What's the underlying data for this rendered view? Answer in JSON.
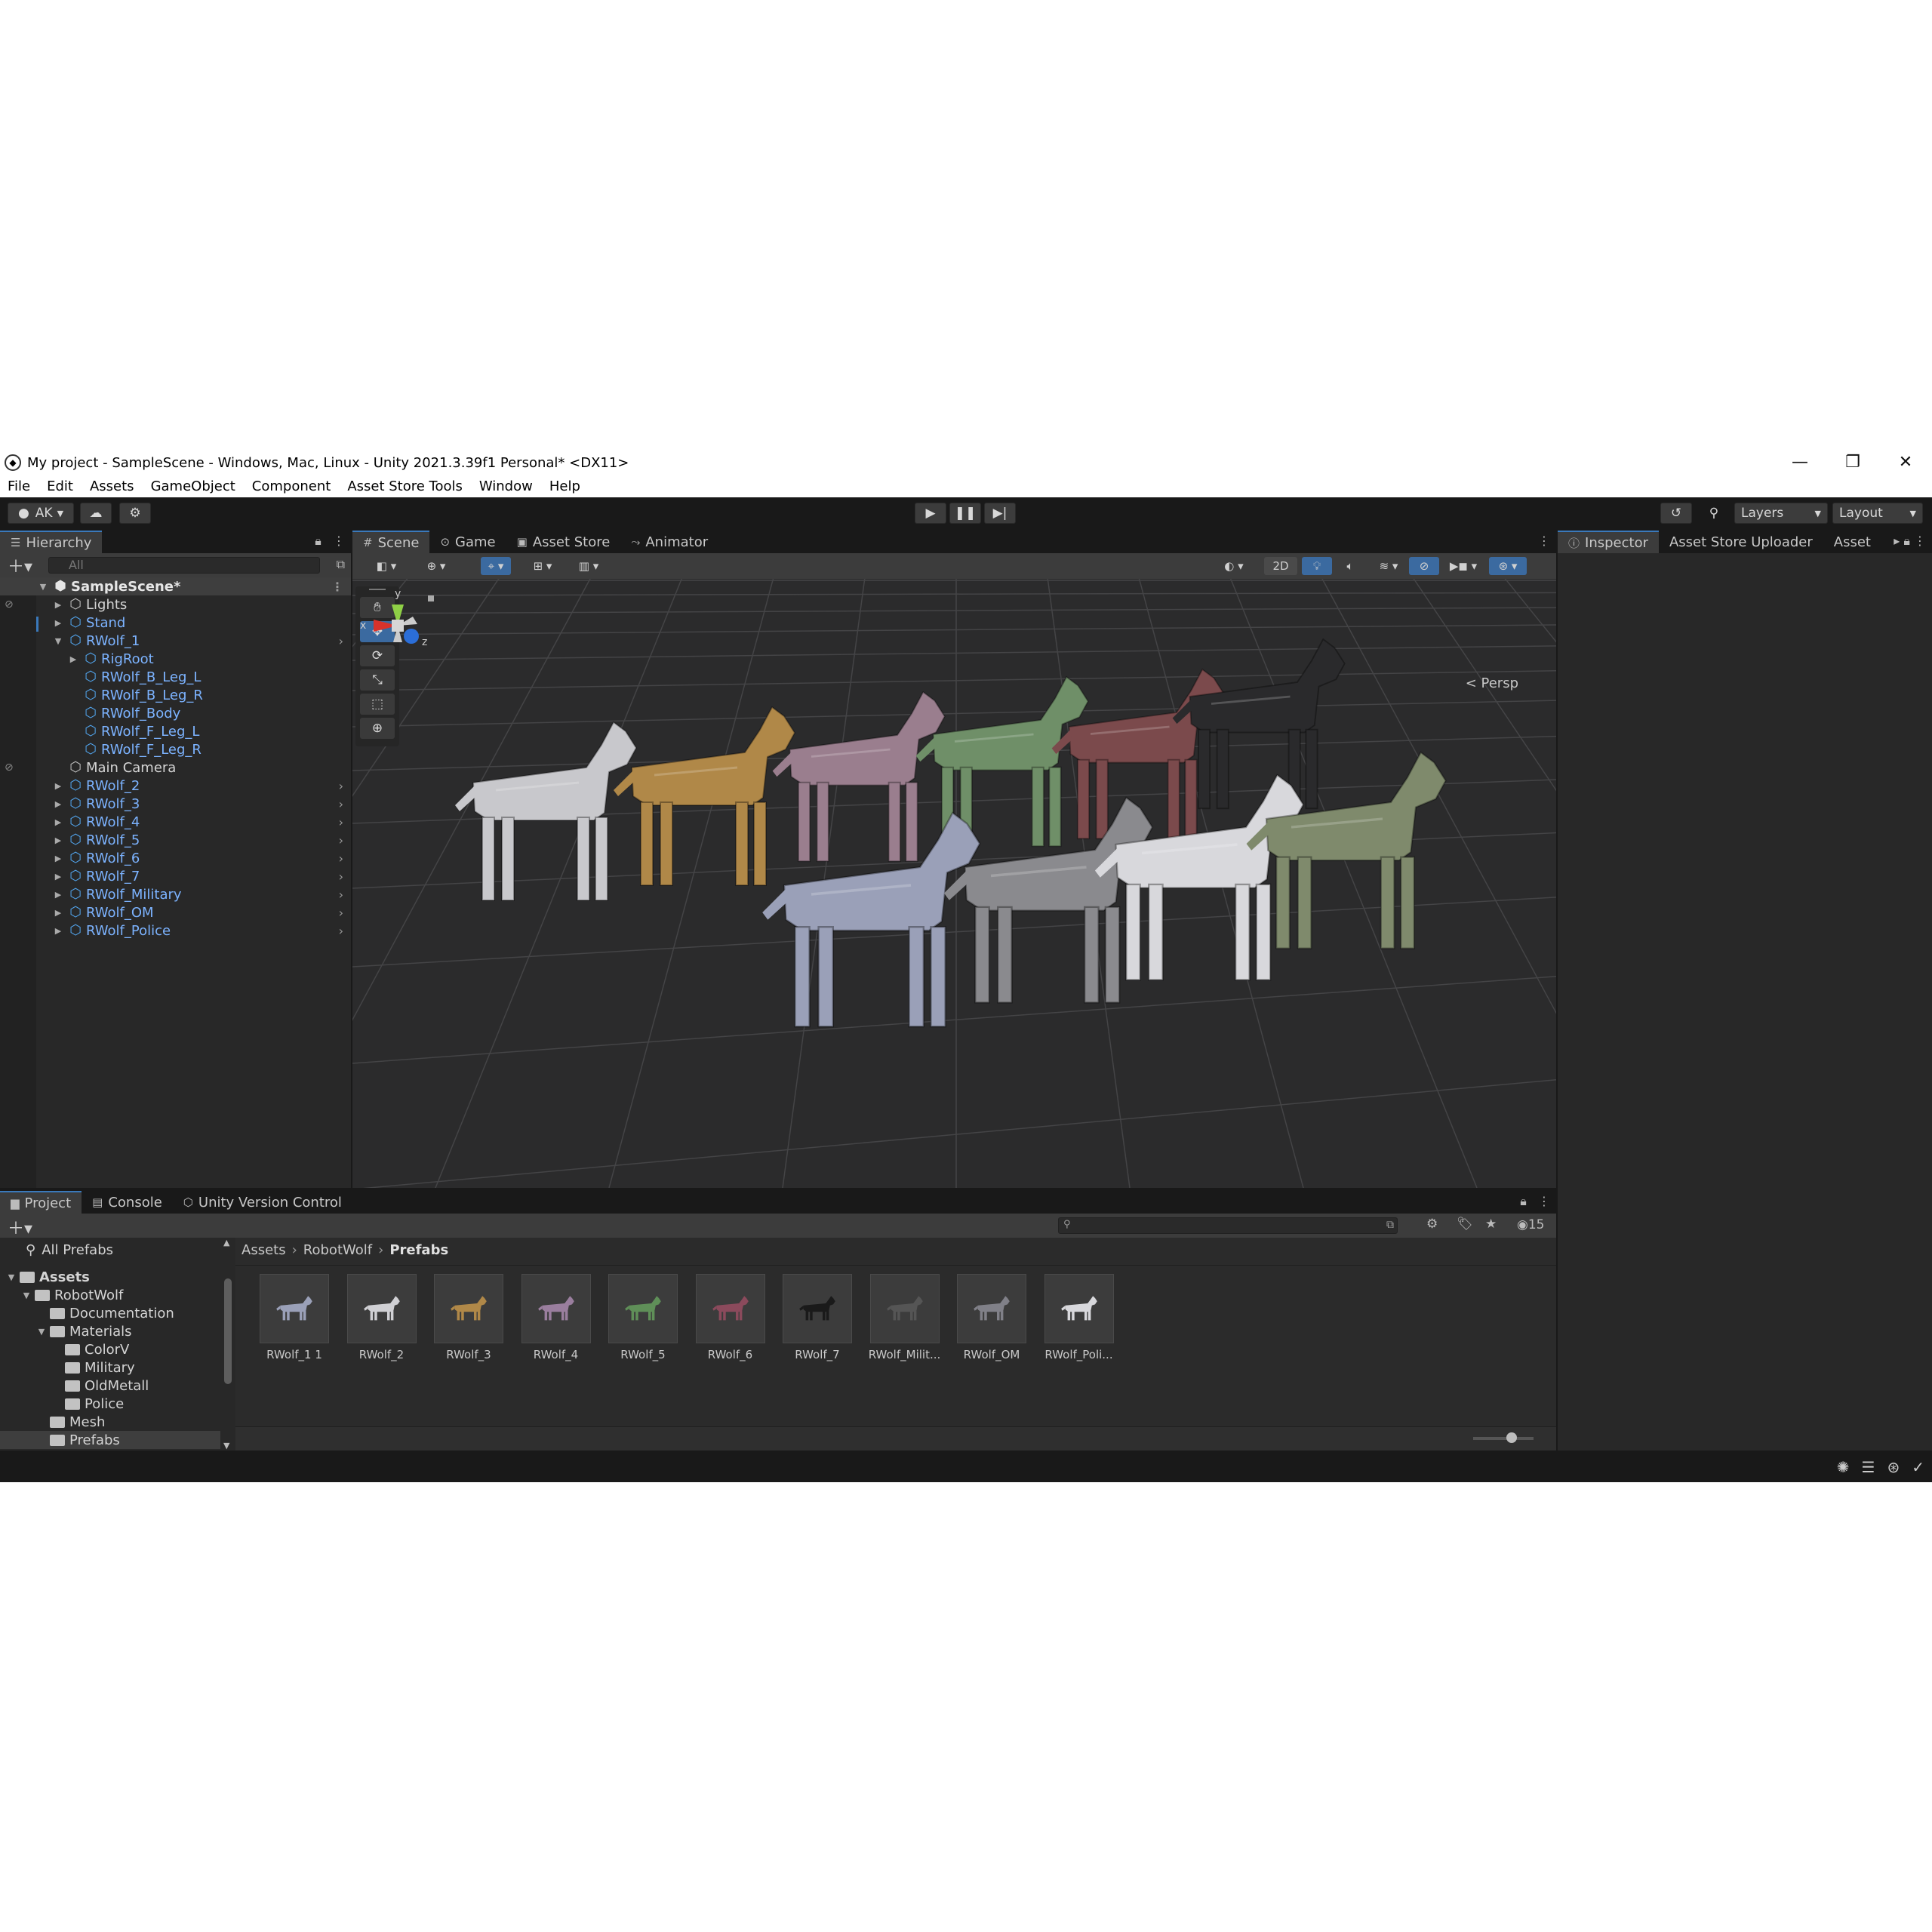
{
  "window": {
    "title": "My project - SampleScene - Windows, Mac, Linux - Unity 2021.3.39f1 Personal* <DX11>",
    "minimize_icon": "minimize-icon",
    "maximize_icon": "restore-icon",
    "close_icon": "close-icon"
  },
  "menu": [
    "File",
    "Edit",
    "Assets",
    "GameObject",
    "Component",
    "Asset Store Tools",
    "Window",
    "Help"
  ],
  "toolbar": {
    "account": "AK",
    "layers": "Layers",
    "layout": "Layout"
  },
  "hierarchy": {
    "tab": "Hierarchy",
    "search_placeholder": "All",
    "rows": [
      {
        "name": "SampleScene*",
        "kind": "scene",
        "indent": 0,
        "arrow": "▼"
      },
      {
        "name": "Lights",
        "kind": "plain",
        "indent": 1,
        "arrow": "▶"
      },
      {
        "name": "Stand",
        "kind": "prefab",
        "indent": 1,
        "arrow": "▶"
      },
      {
        "name": "RWolf_1",
        "kind": "prefab",
        "indent": 1,
        "arrow": "▼",
        "chev": true
      },
      {
        "name": "RigRoot",
        "kind": "prefab",
        "indent": 2,
        "arrow": "▶"
      },
      {
        "name": "RWolf_B_Leg_L",
        "kind": "prefab",
        "indent": 2,
        "arrow": ""
      },
      {
        "name": "RWolf_B_Leg_R",
        "kind": "prefab",
        "indent": 2,
        "arrow": ""
      },
      {
        "name": "RWolf_Body",
        "kind": "prefab",
        "indent": 2,
        "arrow": ""
      },
      {
        "name": "RWolf_F_Leg_L",
        "kind": "prefab",
        "indent": 2,
        "arrow": ""
      },
      {
        "name": "RWolf_F_Leg_R",
        "kind": "prefab",
        "indent": 2,
        "arrow": ""
      },
      {
        "name": "Main Camera",
        "kind": "plain",
        "indent": 1,
        "arrow": ""
      },
      {
        "name": "RWolf_2",
        "kind": "prefab",
        "indent": 1,
        "arrow": "▶",
        "chev": true
      },
      {
        "name": "RWolf_3",
        "kind": "prefab",
        "indent": 1,
        "arrow": "▶",
        "chev": true
      },
      {
        "name": "RWolf_4",
        "kind": "prefab",
        "indent": 1,
        "arrow": "▶",
        "chev": true
      },
      {
        "name": "RWolf_5",
        "kind": "prefab",
        "indent": 1,
        "arrow": "▶",
        "chev": true
      },
      {
        "name": "RWolf_6",
        "kind": "prefab",
        "indent": 1,
        "arrow": "▶",
        "chev": true
      },
      {
        "name": "RWolf_7",
        "kind": "prefab",
        "indent": 1,
        "arrow": "▶",
        "chev": true
      },
      {
        "name": "RWolf_Military",
        "kind": "prefab",
        "indent": 1,
        "arrow": "▶",
        "chev": true
      },
      {
        "name": "RWolf_OM",
        "kind": "prefab",
        "indent": 1,
        "arrow": "▶",
        "chev": true
      },
      {
        "name": "RWolf_Police",
        "kind": "prefab",
        "indent": 1,
        "arrow": "▶",
        "chev": true
      }
    ]
  },
  "scene": {
    "tabs": [
      "Scene",
      "Game",
      "Asset Store",
      "Animator"
    ],
    "mode_2d": "2D",
    "persp": "Persp",
    "gizmo": {
      "x": "x",
      "y": "y",
      "z": "z"
    },
    "wolves": [
      {
        "color": "#c8c8cc"
      },
      {
        "color": "#b08848"
      },
      {
        "color": "#9a7e8e"
      },
      {
        "color": "#6f8f68"
      },
      {
        "color": "#7b4a4c"
      },
      {
        "color": "#2a2a2c"
      },
      {
        "color": "#9aa0b8"
      },
      {
        "color": "#8a8a8e"
      },
      {
        "color": "#d8d8dc"
      },
      {
        "color": "#7f8a6c"
      }
    ]
  },
  "inspector": {
    "tabs": [
      "Inspector",
      "Asset Store Uploader",
      "Asset"
    ]
  },
  "project": {
    "tabs": [
      "Project",
      "Console",
      "Unity Version Control"
    ],
    "count": "15",
    "tree": [
      {
        "name": "All Prefabs",
        "indent": 0,
        "type": "search"
      },
      {
        "name": "Assets",
        "indent": 0,
        "type": "folder",
        "arrow": "▼",
        "bold": true
      },
      {
        "name": "RobotWolf",
        "indent": 1,
        "type": "folder",
        "arrow": "▼"
      },
      {
        "name": "Documentation",
        "indent": 2,
        "type": "folder"
      },
      {
        "name": "Materials",
        "indent": 2,
        "type": "folder",
        "arrow": "▼"
      },
      {
        "name": "ColorV",
        "indent": 3,
        "type": "folder"
      },
      {
        "name": "Military",
        "indent": 3,
        "type": "folder"
      },
      {
        "name": "OldMetall",
        "indent": 3,
        "type": "folder"
      },
      {
        "name": "Police",
        "indent": 3,
        "type": "folder"
      },
      {
        "name": "Mesh",
        "indent": 2,
        "type": "folder"
      },
      {
        "name": "Prefabs",
        "indent": 2,
        "type": "folder",
        "selected": true
      }
    ],
    "breadcrumb": [
      "Assets",
      "RobotWolf",
      "Prefabs"
    ],
    "assets": [
      {
        "label": "RWolf_1 1",
        "color": "#9aa0b8"
      },
      {
        "label": "RWolf_2",
        "color": "#d0d0d4"
      },
      {
        "label": "RWolf_3",
        "color": "#b08848"
      },
      {
        "label": "RWolf_4",
        "color": "#9a7e9e"
      },
      {
        "label": "RWolf_5",
        "color": "#5f8f58"
      },
      {
        "label": "RWolf_6",
        "color": "#8b4a5c"
      },
      {
        "label": "RWolf_7",
        "color": "#1a1a1a"
      },
      {
        "label": "RWolf_Milit...",
        "color": "#555555"
      },
      {
        "label": "RWolf_OM",
        "color": "#808088"
      },
      {
        "label": "RWolf_Poli...",
        "color": "#d8d8dc"
      }
    ]
  }
}
